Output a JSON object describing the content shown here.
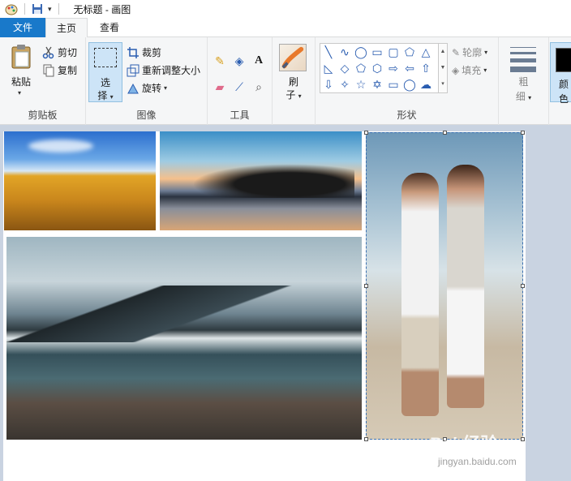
{
  "window": {
    "title": "无标题 - 画图"
  },
  "tabs": [
    {
      "label": "文件"
    },
    {
      "label": "主页"
    },
    {
      "label": "查看"
    }
  ],
  "clipboard": {
    "group_label": "剪贴板",
    "paste_label": "粘贴",
    "cut_label": "剪切",
    "copy_label": "复制"
  },
  "image": {
    "group_label": "图像",
    "select_label_1": "选",
    "select_label_2": "择",
    "crop_label": "裁剪",
    "resize_label": "重新调整大小",
    "rotate_label": "旋转"
  },
  "tools": {
    "group_label": "工具"
  },
  "brushes": {
    "label_1": "刷",
    "label_2": "子"
  },
  "shapes": {
    "group_label": "形状",
    "outline_label": "轮廓",
    "fill_label": "填充",
    "items": [
      "line",
      "curve",
      "oval",
      "rectangle",
      "rounded-rectangle",
      "polygon",
      "triangle",
      "right-triangle",
      "diamond",
      "pentagon",
      "hexagon",
      "right-arrow",
      "left-arrow",
      "up-arrow",
      "down-arrow",
      "four-point-star",
      "five-point-star",
      "six-point-star",
      "callout-rect",
      "callout-oval",
      "callout-cloud"
    ]
  },
  "size": {
    "label_1": "粗",
    "label_2": "细"
  },
  "color": {
    "label_1": "颜",
    "label_2": "色",
    "current": "#000000"
  },
  "accent": {
    "file_tab": "#1979ca",
    "selected_btn": "#cde4f7"
  },
  "watermark": {
    "text": "Bai 经验",
    "sub": "jingyan.baidu.com"
  }
}
